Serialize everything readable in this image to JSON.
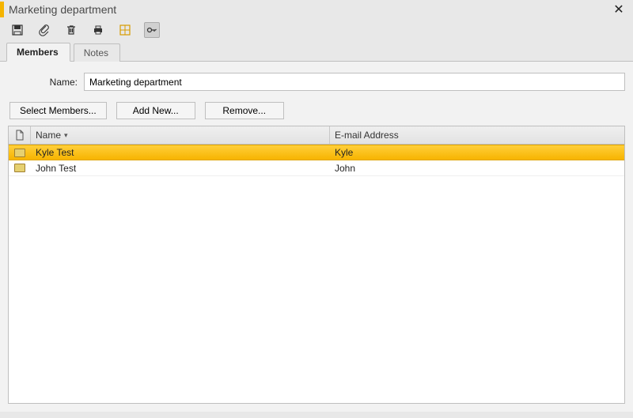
{
  "window": {
    "title": "Marketing department"
  },
  "tabs": [
    {
      "label": "Members",
      "active": true
    },
    {
      "label": "Notes",
      "active": false
    }
  ],
  "form": {
    "name_label": "Name:",
    "name_value": "Marketing department"
  },
  "buttons": {
    "select_members": "Select Members...",
    "add_new": "Add New...",
    "remove": "Remove..."
  },
  "columns": {
    "name": "Name",
    "email": "E-mail Address"
  },
  "rows": [
    {
      "name": "Kyle Test",
      "email": "Kyle",
      "selected": true
    },
    {
      "name": "John Test",
      "email": "John",
      "selected": false
    }
  ]
}
